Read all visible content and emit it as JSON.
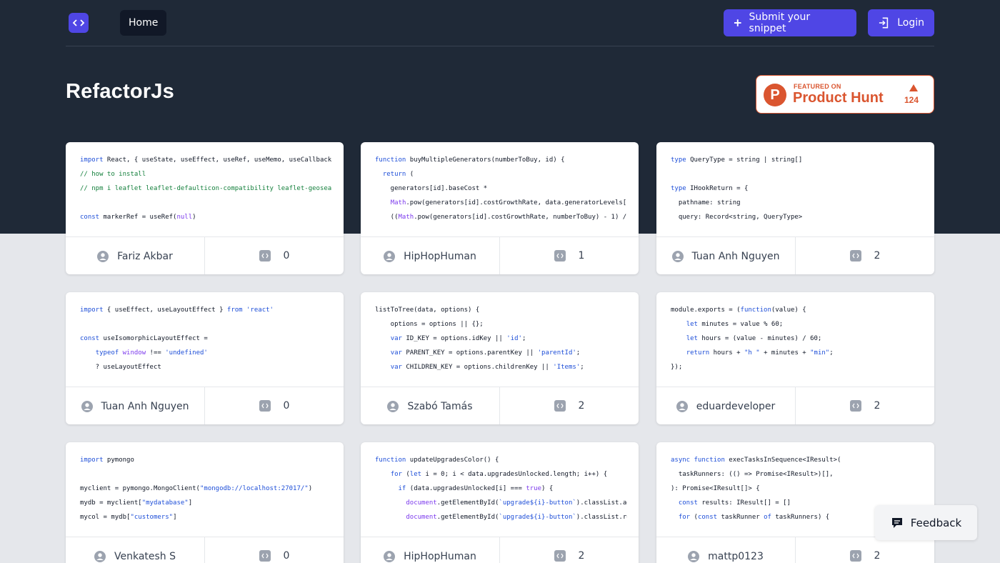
{
  "nav": {
    "home_label": "Home",
    "submit_label": "Submit your snippet",
    "login_label": "Login"
  },
  "page": {
    "title": "RefactorJs"
  },
  "product_hunt": {
    "letter": "P",
    "featured": "FEATURED ON",
    "name": "Product Hunt",
    "count": "124",
    "color": "#da552f"
  },
  "colors": {
    "accent": "#4f46e5",
    "header_bg": "#1f2937",
    "page_bg": "#e5e7eb"
  },
  "cards": [
    {
      "author": "Fariz Akbar",
      "count": "0",
      "lines": [
        "import React, { useState, useEffect, useRef, useMemo, useCallback } from",
        "// how to install",
        "// npm i leaflet leaflet-defaulticon-compatibility leaflet-geosearch re",
        "",
        "const markerRef = useRef(null)"
      ]
    },
    {
      "author": "HipHopHuman",
      "count": "1",
      "lines": [
        "function buyMultipleGenerators(numberToBuy, id) {",
        "  return (",
        "    generators[id].baseCost *",
        "    Math.pow(generators[id].costGrowthRate, data.generatorLevels[id]) *",
        "    ((Math.pow(generators[id].costGrowthRate, numberToBuy) - 1) /"
      ]
    },
    {
      "author": "Tuan Anh Nguyen",
      "count": "2",
      "lines": [
        "type QueryType = string | string[]",
        "",
        "type IHookReturn = {",
        "  pathname: string",
        "  query: Record<string, QueryType>"
      ]
    },
    {
      "author": "Tuan Anh Nguyen",
      "count": "0",
      "lines": [
        "import { useEffect, useLayoutEffect } from 'react'",
        "",
        "const useIsomorphicLayoutEffect =",
        "    typeof window !== 'undefined'",
        "    ? useLayoutEffect"
      ]
    },
    {
      "author": "Szabó Tamás",
      "count": "2",
      "lines": [
        "listToTree(data, options) {",
        "    options = options || {};",
        "    var ID_KEY = options.idKey || 'id';",
        "    var PARENT_KEY = options.parentKey || 'parentId';",
        "    var CHILDREN_KEY = options.childrenKey || 'Items';"
      ]
    },
    {
      "author": "eduardeveloper",
      "count": "2",
      "lines": [
        "module.exports = (function(value) {",
        "    let minutes = value % 60;",
        "    let hours = (value - minutes) / 60;",
        "    return hours + \"h \" + minutes + \"min\";",
        "});"
      ]
    },
    {
      "author": "Venkatesh S",
      "count": "0",
      "lines": [
        "import pymongo",
        "",
        "myclient = pymongo.MongoClient(\"mongodb://localhost:27017/\")",
        "mydb = myclient[\"mydatabase\"]",
        "mycol = mydb[\"customers\"]"
      ]
    },
    {
      "author": "HipHopHuman",
      "count": "2",
      "lines": [
        "function updateUpgradesColor() {",
        "    for (let i = 0; i < data.upgradesUnlocked.length; i++) {",
        "      if (data.upgradesUnlocked[i] === true) {",
        "        document.getElementById(`upgrade${i}-button`).classList.add",
        "        document.getElementById(`upgrade${i}-button`).classList.rem"
      ]
    },
    {
      "author": "mattp0123",
      "count": "2",
      "lines": [
        "async function execTasksInSequence<IResult>(",
        "  taskRunners: (() => Promise<IResult>)[],",
        "): Promise<IResult[]> {",
        "  const results: IResult[] = []",
        "  for (const taskRunner of taskRunners) {"
      ]
    }
  ],
  "feedback": {
    "label": "Feedback"
  }
}
